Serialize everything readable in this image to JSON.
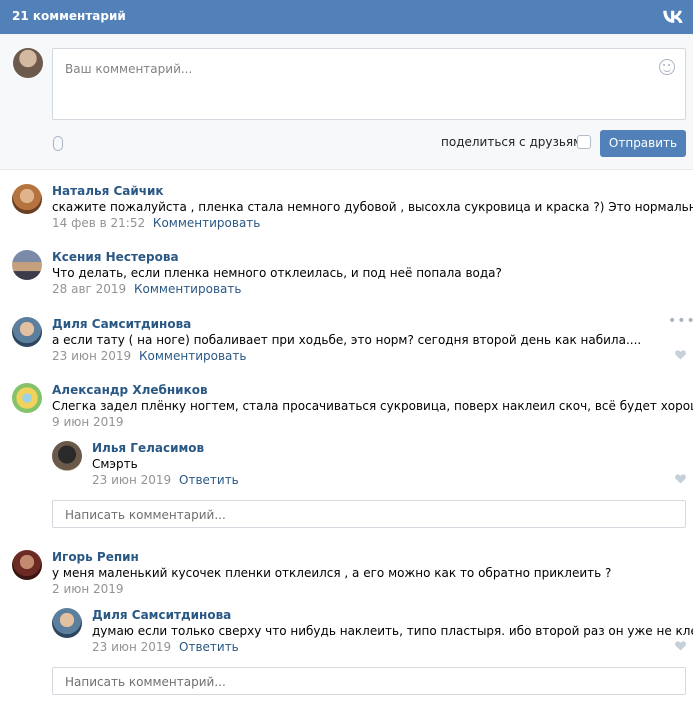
{
  "header": {
    "title": "21 комментарий",
    "logo_icon": "vk-logo-icon"
  },
  "composer": {
    "placeholder": "Ваш комментарий...",
    "share_label": "поделиться с друзьями",
    "send_label": "Отправить"
  },
  "comments": [
    {
      "author": "Наталья Сайчик",
      "text": "скажите пожалуйста , пленка стала немного дубовой , высохла сукровица и краска ?) Это нормально ?",
      "date": "14 фев в 21:52",
      "action": "Комментировать"
    },
    {
      "author": "Ксения Нестерова",
      "text": "Что делать, если пленка немного отклеилась, и под неё попала вода?",
      "date": "28 авг 2019",
      "action": "Комментировать"
    },
    {
      "author": "Диля Самситдинова",
      "text": "а если тату ( на ноге) побаливает при ходьбе, это норм? сегодня второй день как набила....",
      "date": "23 июн 2019",
      "action": "Комментировать"
    },
    {
      "author": "Александр Хлебников",
      "text": "Слегка задел плёнку ногтем, стала просачиваться сукровица, поверх наклеил скоч, всё будет хорошо?)",
      "date": "9 июн 2019",
      "action": ""
    },
    {
      "author": "Игорь Репин",
      "text": "у меня маленький кусочек пленки отклеился , а его можно как то обратно приклеить ?",
      "date": "2 июн 2019",
      "action": ""
    }
  ],
  "replies": [
    {
      "author": "Илья Геласимов",
      "text": "Смэрть",
      "date": "23 июн 2019",
      "action": "Ответить"
    },
    {
      "author": "Диля Самситдинова",
      "text": "думаю если только сверху что нибудь наклеить, типо пластыря. ибо второй раз он уже не клеится",
      "date": "23 июн 2019",
      "action": "Ответить"
    }
  ],
  "write_placeholder": "Написать комментарий...",
  "colors": {
    "header": "#5181b8",
    "link": "#2a5885",
    "meta": "#939393"
  }
}
